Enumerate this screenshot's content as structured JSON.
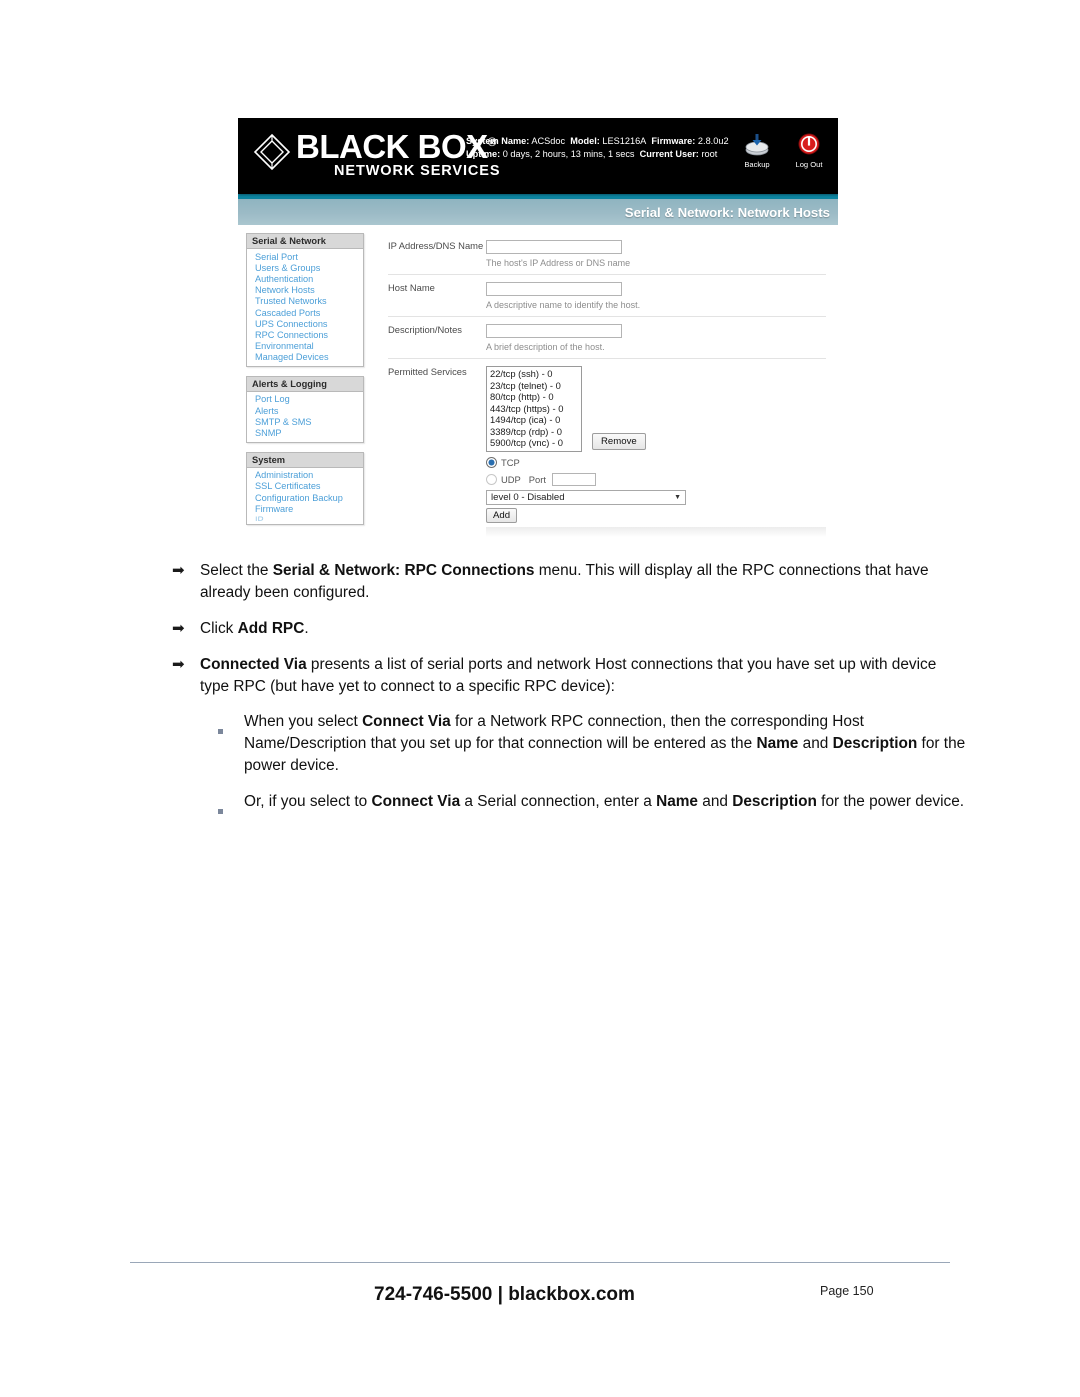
{
  "screenshot": {
    "header": {
      "logo_title": "BLACK BOX",
      "logo_subtitle": "NETWORK SERVICES",
      "logo_reg": "®",
      "info_line1_labels": [
        "System Name:",
        "Model:",
        "Firmware:"
      ],
      "info_line1_values": [
        "ACSdoc",
        "LES1216A",
        "2.8.0u2"
      ],
      "info_line2_labels": [
        "Uptime:",
        "Current User:"
      ],
      "info_line2_values": [
        "0 days, 2 hours, 13 mins, 1 secs",
        "root"
      ],
      "icons": [
        {
          "name": "backup-icon",
          "label": "Backup"
        },
        {
          "name": "logout-icon",
          "label": "Log Out"
        }
      ]
    },
    "page_title": "Serial & Network: Network Hosts",
    "sidebar": [
      {
        "heading": "Serial & Network",
        "items": [
          "Serial Port",
          "Users & Groups",
          "Authentication",
          "Network Hosts",
          "Trusted Networks",
          "Cascaded Ports",
          "UPS Connections",
          "RPC Connections",
          "Environmental",
          "Managed Devices"
        ]
      },
      {
        "heading": "Alerts & Logging",
        "items": [
          "Port Log",
          "Alerts",
          "SMTP & SMS",
          "SNMP"
        ]
      },
      {
        "heading": "System",
        "items": [
          "Administration",
          "SSL Certificates",
          "Configuration Backup",
          "Firmware",
          "IP"
        ]
      }
    ],
    "form": {
      "rows": [
        {
          "label": "IP Address/DNS Name",
          "value": "",
          "hint": "The host's IP Address or DNS name"
        },
        {
          "label": "Host Name",
          "value": "",
          "hint": "A descriptive name to identify the host."
        },
        {
          "label": "Description/Notes",
          "value": "",
          "hint": "A brief description of the host."
        }
      ],
      "permitted_services_label": "Permitted Services",
      "permitted_services": [
        "22/tcp (ssh) - 0",
        "23/tcp (telnet) - 0",
        "80/tcp (http) - 0",
        "443/tcp (https) - 0",
        "1494/tcp (ica) - 0",
        "3389/tcp (rdp) - 0",
        "5900/tcp (vnc) - 0"
      ],
      "remove_button": "Remove",
      "tcp_label": "TCP",
      "udp_label": "UDP",
      "port_label": "Port",
      "port_value": "",
      "level_select_value": "level 0 - Disabled",
      "add_button": "Add"
    }
  },
  "document": {
    "bullets": [
      {
        "level": 1,
        "runs": [
          {
            "t": "Select the ",
            "b": false
          },
          {
            "t": "Serial & Network: RPC Connections",
            "b": true
          },
          {
            "t": " menu. This will display all the RPC connections that have already been configured.",
            "b": false
          }
        ]
      },
      {
        "level": 1,
        "runs": [
          {
            "t": "Click ",
            "b": false
          },
          {
            "t": "Add RPC",
            "b": true
          },
          {
            "t": ".",
            "b": false
          }
        ]
      },
      {
        "level": 1,
        "runs": [
          {
            "t": "Connected Via",
            "b": true
          },
          {
            "t": " presents a list of serial ports and network Host connections that you have set up with device type RPC (but have yet to connect to a specific RPC device):",
            "b": false
          }
        ]
      },
      {
        "level": 2,
        "runs": [
          {
            "t": "When you select ",
            "b": false
          },
          {
            "t": "Connect Via",
            "b": true
          },
          {
            "t": " for a Network RPC connection, then the corresponding Host Name/Description that you set up for that connection will be entered as the ",
            "b": false
          },
          {
            "t": "Name",
            "b": true
          },
          {
            "t": " and ",
            "b": false
          },
          {
            "t": "Description",
            "b": true
          },
          {
            "t": " for the power device.",
            "b": false
          }
        ]
      },
      {
        "level": 2,
        "runs": [
          {
            "t": "Or, if you select to ",
            "b": false
          },
          {
            "t": "Connect Via",
            "b": true
          },
          {
            "t": " a Serial connection, enter a ",
            "b": false
          },
          {
            "t": "Name",
            "b": true
          },
          {
            "t": " and ",
            "b": false
          },
          {
            "t": "Description",
            "b": true
          },
          {
            "t": " for the power device.",
            "b": false
          }
        ]
      }
    ]
  },
  "footer": {
    "contact": "724-746-5500 | blackbox.com",
    "page": "Page 150"
  }
}
